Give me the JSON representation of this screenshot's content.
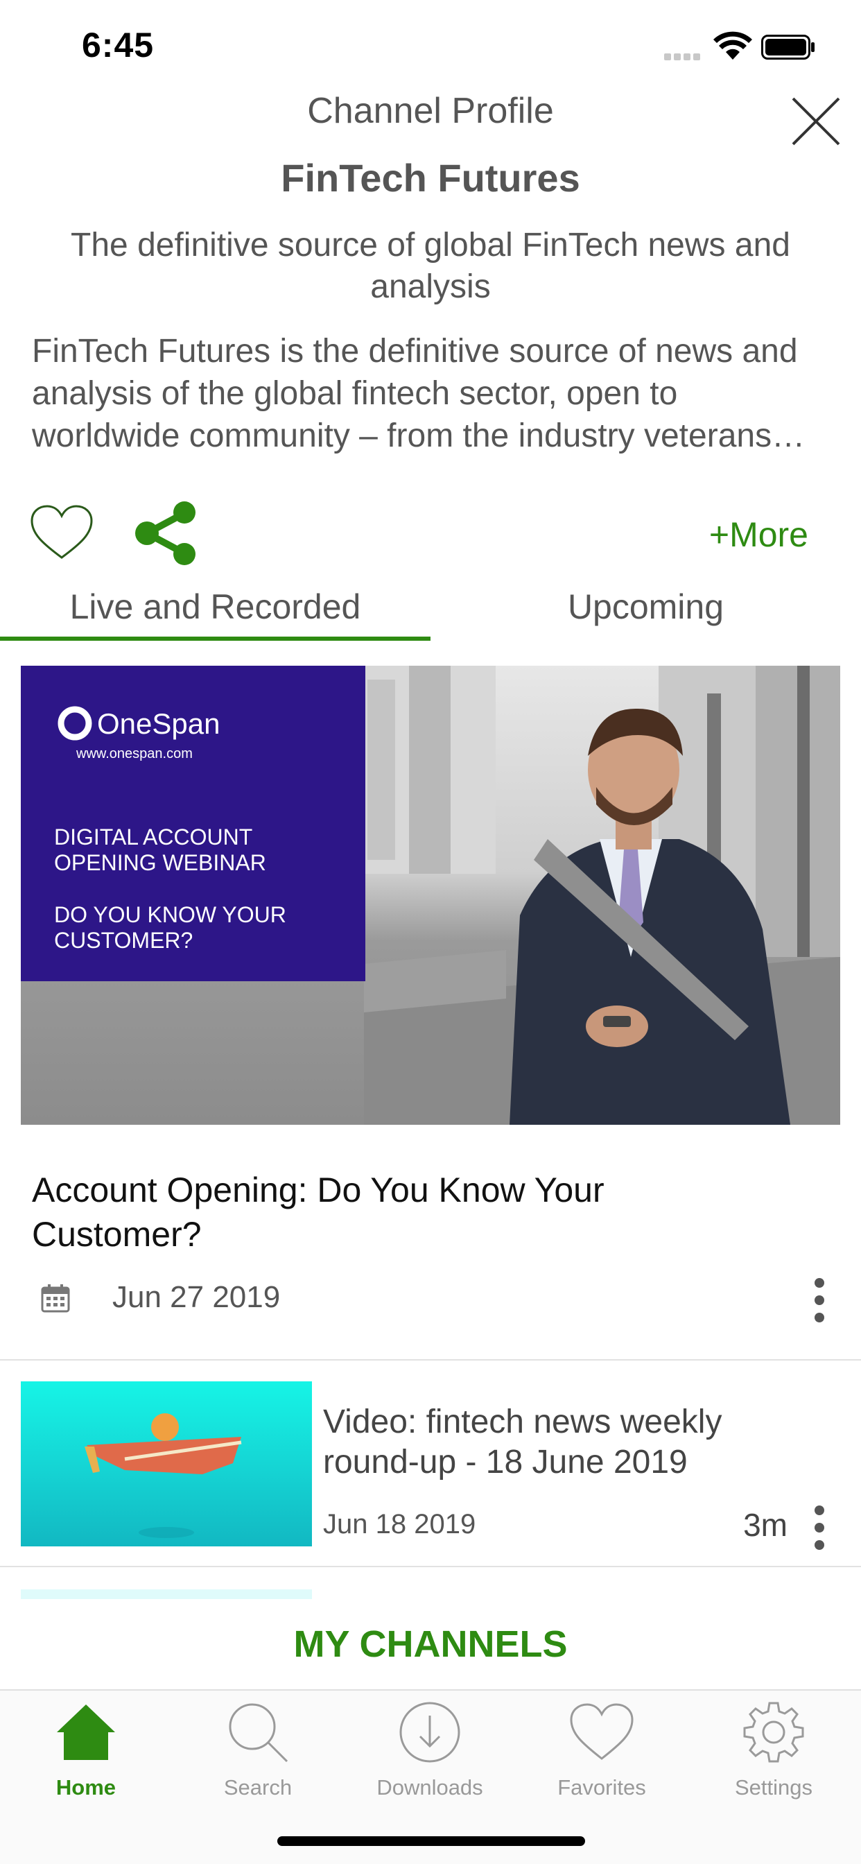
{
  "status_bar": {
    "time": "6:45"
  },
  "header": {
    "label": "Channel Profile",
    "channel_name": "FinTech Futures",
    "tagline": "The definitive source of global FinTech news and analysis",
    "description": "FinTech Futures is the definitive source of news and analysis of the global fintech sector, open to worldwide community – from the industry veterans…"
  },
  "actions": {
    "more_label": "+More"
  },
  "tabs": [
    {
      "label": "Live and Recorded",
      "active": true
    },
    {
      "label": "Upcoming",
      "active": false
    }
  ],
  "featured": {
    "image_brand": "OneSpan",
    "image_url_text": "www.onespan.com",
    "image_line1": "DIGITAL ACCOUNT",
    "image_line2": "OPENING WEBINAR",
    "image_line3": "DO YOU KNOW YOUR",
    "image_line4": "CUSTOMER?",
    "title": "Account Opening: Do You Know Your Customer?",
    "date": "Jun 27 2019"
  },
  "items": [
    {
      "title": "Video: fintech news weekly round-up - 18 June 2019",
      "date": "Jun 18 2019",
      "duration": "3m"
    }
  ],
  "my_channels_label": "MY CHANNELS",
  "tab_bar": [
    {
      "label": "Home",
      "icon": "home-icon",
      "active": true
    },
    {
      "label": "Search",
      "icon": "search-icon",
      "active": false
    },
    {
      "label": "Downloads",
      "icon": "download-icon",
      "active": false
    },
    {
      "label": "Favorites",
      "icon": "heart-icon",
      "active": false
    },
    {
      "label": "Settings",
      "icon": "gear-icon",
      "active": false
    }
  ],
  "colors": {
    "accent": "#2e8b12",
    "brand_purple": "#2d1688"
  }
}
